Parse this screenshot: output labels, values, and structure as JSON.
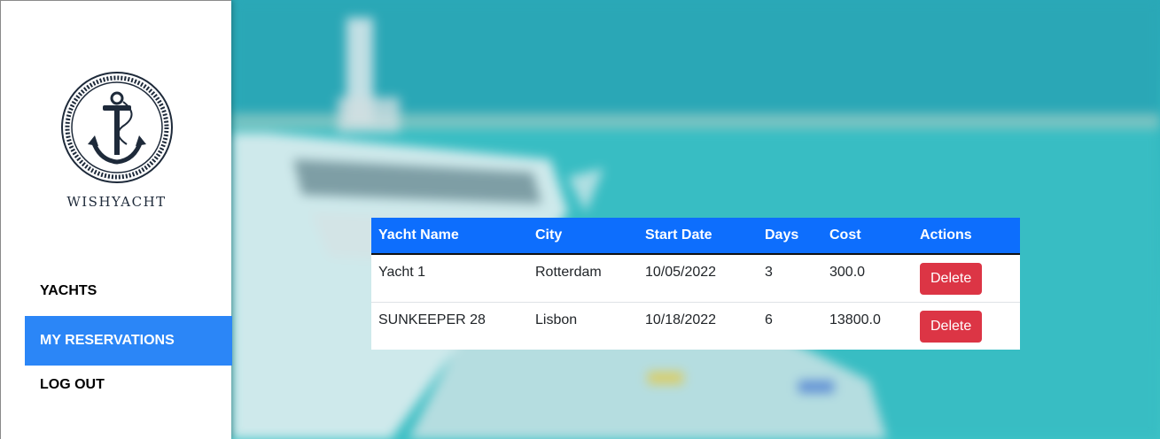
{
  "brand": {
    "name": "WISHYACHT",
    "logo_icon": "anchor-icon"
  },
  "nav": {
    "items": [
      {
        "label": "YACHTS",
        "active": false
      },
      {
        "label": "MY RESERVATIONS",
        "active": true
      },
      {
        "label": "LOG OUT",
        "active": false
      }
    ]
  },
  "reservations": {
    "columns": [
      "Yacht Name",
      "City",
      "Start Date",
      "Days",
      "Cost",
      "Actions"
    ],
    "rows": [
      {
        "yacht": "Yacht 1",
        "city": "Rotterdam",
        "start": "10/05/2022",
        "days": "3",
        "cost": "300.0",
        "action": "Delete"
      },
      {
        "yacht": "SUNKEEPER 28",
        "city": "Lisbon",
        "start": "10/18/2022",
        "days": "6",
        "cost": "13800.0",
        "action": "Delete"
      }
    ]
  },
  "colors": {
    "accent": "#0d6efd",
    "nav_active": "#2b86f7",
    "danger": "#dc3545",
    "sea": "#32b8c0"
  }
}
